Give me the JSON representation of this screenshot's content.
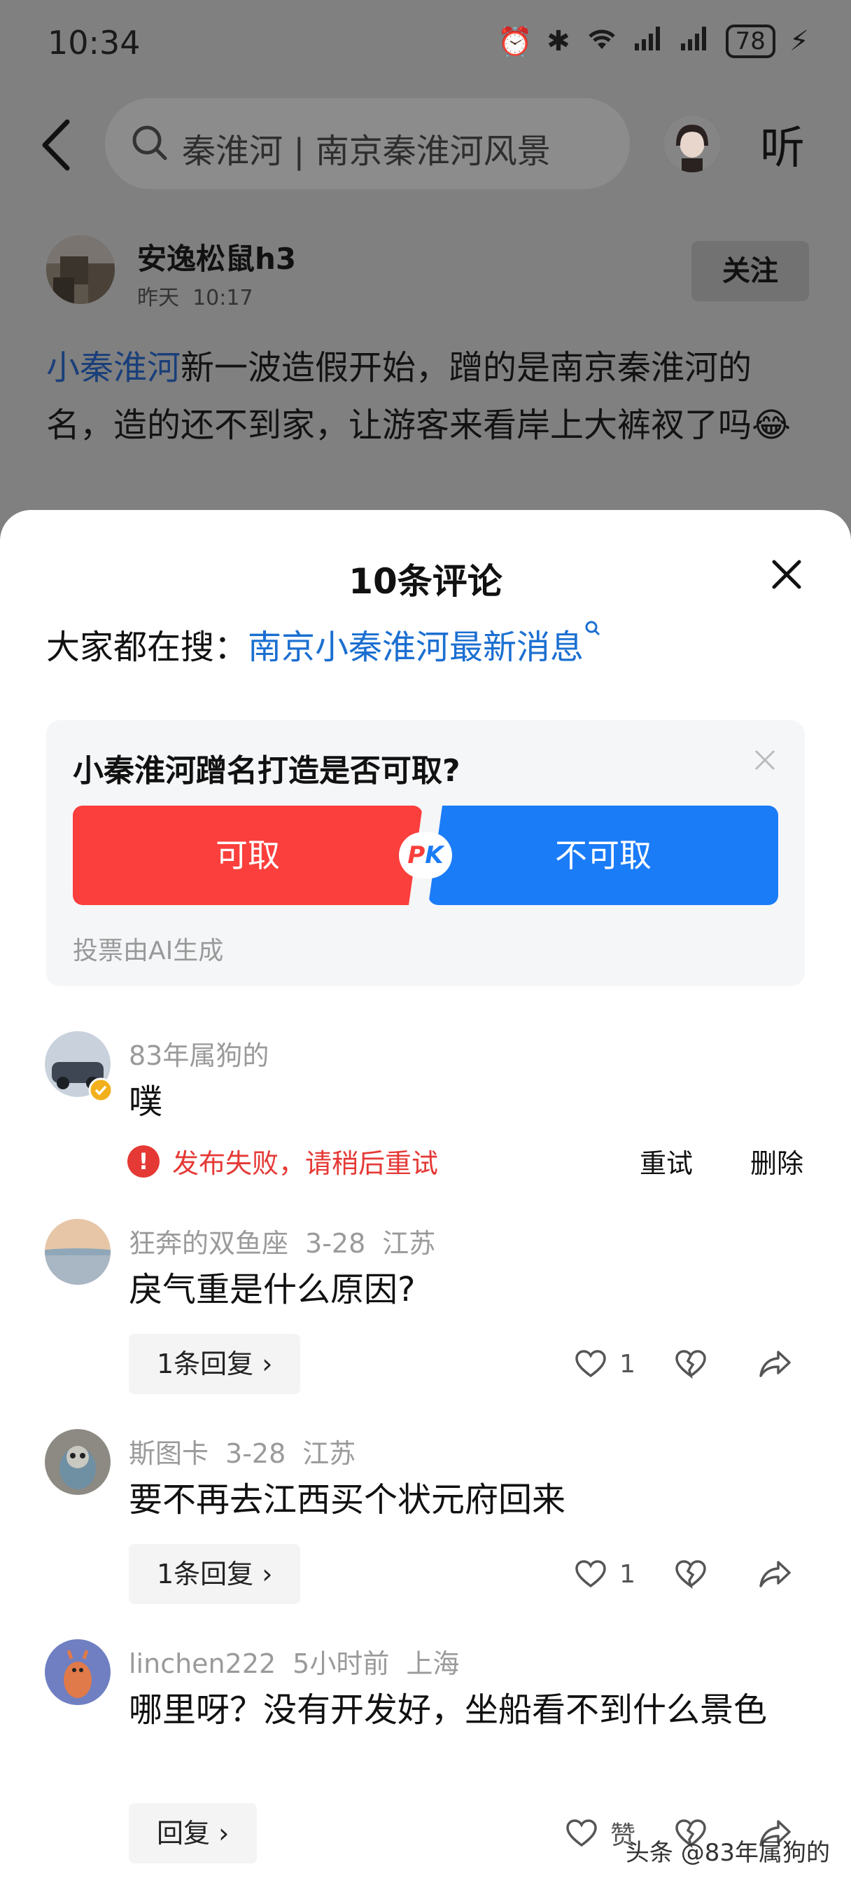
{
  "status_bar": {
    "time": "10:34",
    "battery": "78"
  },
  "top_bar": {
    "search_text": "秦淮河 | 南京秦淮河风景",
    "listen_label": "听"
  },
  "author": {
    "name": "安逸松鼠h3",
    "date": "昨天",
    "time": "10:17",
    "follow_label": "关注"
  },
  "post": {
    "link_text": "小秦淮河",
    "text": "新一波造假开始，蹭的是南京秦淮河的名，造的还不到家，让游客来看岸上大裤衩了吗😂"
  },
  "comments_sheet": {
    "title": "10条评论",
    "hot_search_label": "大家都在搜：",
    "hot_search_link": "南京小秦淮河最新消息",
    "vote": {
      "question": "小秦淮河蹭名打造是否可取?",
      "yes_label": "可取",
      "no_label": "不可取",
      "pk_p": "P",
      "pk_k": "K",
      "ai_note": "投票由AI生成"
    },
    "comments": [
      {
        "user": "83年属狗的",
        "text": "噗",
        "fail_message": "发布失败，请稍后重试",
        "retry_label": "重试",
        "delete_label": "删除"
      },
      {
        "user": "狂奔的双鱼座",
        "date": "3-28",
        "location": "江苏",
        "text": "戾气重是什么原因?",
        "reply_label": "1条回复 ›",
        "likes": "1"
      },
      {
        "user": "斯图卡",
        "date": "3-28",
        "location": "江苏",
        "text": "要不再去江西买个状元府回来",
        "reply_label": "1条回复 ›",
        "likes": "1"
      },
      {
        "user": "linchen222",
        "date": "5小时前",
        "location": "上海",
        "text": "哪里呀？没有开发好，坐船看不到什么景色",
        "reply_label": "回复 ›",
        "likes": "赞"
      }
    ]
  },
  "watermark": "头条 @83年属狗的"
}
